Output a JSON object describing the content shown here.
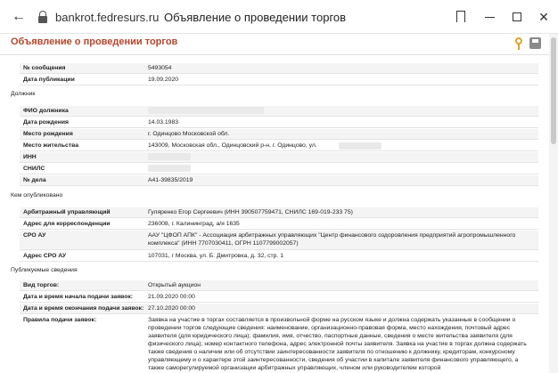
{
  "browser": {
    "url": "bankrot.fedresurs.ru",
    "title": "Объявление о проведении торгов"
  },
  "page": {
    "heading": "Объявление о проведении торгов",
    "message": [
      {
        "label": "№ сообщения",
        "value": "5493054"
      },
      {
        "label": "Дата публикации",
        "value": "19.09.2020"
      }
    ],
    "debtor_section": "Должник",
    "debtor": [
      {
        "label": "ФИО должника",
        "value": ""
      },
      {
        "label": "Дата рождения",
        "value": "14.03.1983"
      },
      {
        "label": "Место рождения",
        "value": "г. Одинцово Московской обл."
      },
      {
        "label": "Место жительства",
        "value": "143009, Московская обл., Одинцовский р-н, г. Одинцово, ул."
      },
      {
        "label": "ИНН",
        "value": ""
      },
      {
        "label": "СНИЛС",
        "value": ""
      },
      {
        "label": "№ дела",
        "value": "А41-39835/2019"
      }
    ],
    "publisher_section": "Кем опубликовано",
    "publisher": [
      {
        "label": "Арбитражный управляющий",
        "value": "Гуляренко  Егор  Сергеевич (ИНН 390507759471,  СНИЛС 169-019-233 75)"
      },
      {
        "label": "Адрес для корреспонденции",
        "value": "236008, г. Калининград, а/я 1635"
      },
      {
        "label": "СРО АУ",
        "value": "ААУ \"ЦФОП АПК\" - Ассоциация арбитражных управляющих \"Центр финансового оздоровления предприятий агропромышленного комплекса\" (ИНН 7707030411,  ОГРН 1107799002057)"
      },
      {
        "label": "Адрес СРО АУ",
        "value": "107031, г Москва, ул. Б. Дмитровка, д. 32, стр. 1"
      }
    ],
    "public_section": "Публикуемые сведения",
    "public": [
      {
        "label": "Вид торгов:",
        "value": "Открытый аукцион"
      },
      {
        "label": "Дата и время начала подачи заявок:",
        "value": "21.09.2020 00:00"
      },
      {
        "label": "Дата и время окончания подачи заявок:",
        "value": "27.10.2020 00:00"
      },
      {
        "label": "Правила подачи заявок:",
        "value": "Заявка на участие в торгах составляется в произвольной форме на русском языке и должна содержать указанные в сообщении о проведении торгов следующие сведения: наименование, организационно-правовая форма, место нахождения, почтовый адрес заявителя (для юридического лица); фамилия, имя, отчество, паспортные данные, сведения о месте жительства заявителя (для физического лица); номер контактного телефона, адрес электронной почты заявителя. Заявка на участие в торгах должна содержать также сведения о наличии или об отсутствии заинтересованности заявителя по отношению к должнику, кредиторам, конкурсному управляющему и о характере этой заинтересованности, сведения об участии в капитале заявителя финансового управляющего, а также саморегулируемой организации арбитражных управляющих, членом или руководителем которой"
      }
    ]
  }
}
